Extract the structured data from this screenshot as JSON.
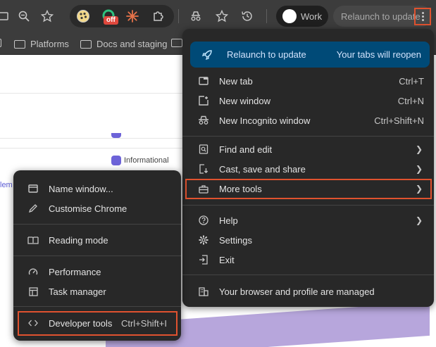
{
  "toolbar": {
    "off_badge": "off",
    "profile_label": "Work",
    "relaunch_label": "Relaunch to update"
  },
  "bookmarks": [
    {
      "label": "Platforms"
    },
    {
      "label": "Docs and staging"
    }
  ],
  "page": {
    "informational": "Informational",
    "left_fragment": "lem"
  },
  "main_menu": {
    "relaunch": {
      "label": "Relaunch to update",
      "note": "Your tabs will reopen"
    },
    "new_tab": {
      "label": "New tab",
      "shortcut": "Ctrl+T"
    },
    "new_window": {
      "label": "New window",
      "shortcut": "Ctrl+N"
    },
    "new_incognito": {
      "label": "New Incognito window",
      "shortcut": "Ctrl+Shift+N"
    },
    "find_edit": {
      "label": "Find and edit"
    },
    "cast_save_share": {
      "label": "Cast, save and share"
    },
    "more_tools": {
      "label": "More tools"
    },
    "help": {
      "label": "Help"
    },
    "settings": {
      "label": "Settings"
    },
    "exit": {
      "label": "Exit"
    },
    "managed": {
      "label": "Your browser and profile are managed"
    }
  },
  "sub_menu": {
    "name_window": {
      "label": "Name window..."
    },
    "customise": {
      "label": "Customise Chrome"
    },
    "reading_mode": {
      "label": "Reading mode"
    },
    "performance": {
      "label": "Performance"
    },
    "task_manager": {
      "label": "Task manager"
    },
    "developer_tools": {
      "label": "Developer tools",
      "shortcut": "Ctrl+Shift+I"
    }
  },
  "colors": {
    "highlight": "#e0522f",
    "relaunch_bg": "#004a77",
    "menu_bg": "#282828"
  }
}
